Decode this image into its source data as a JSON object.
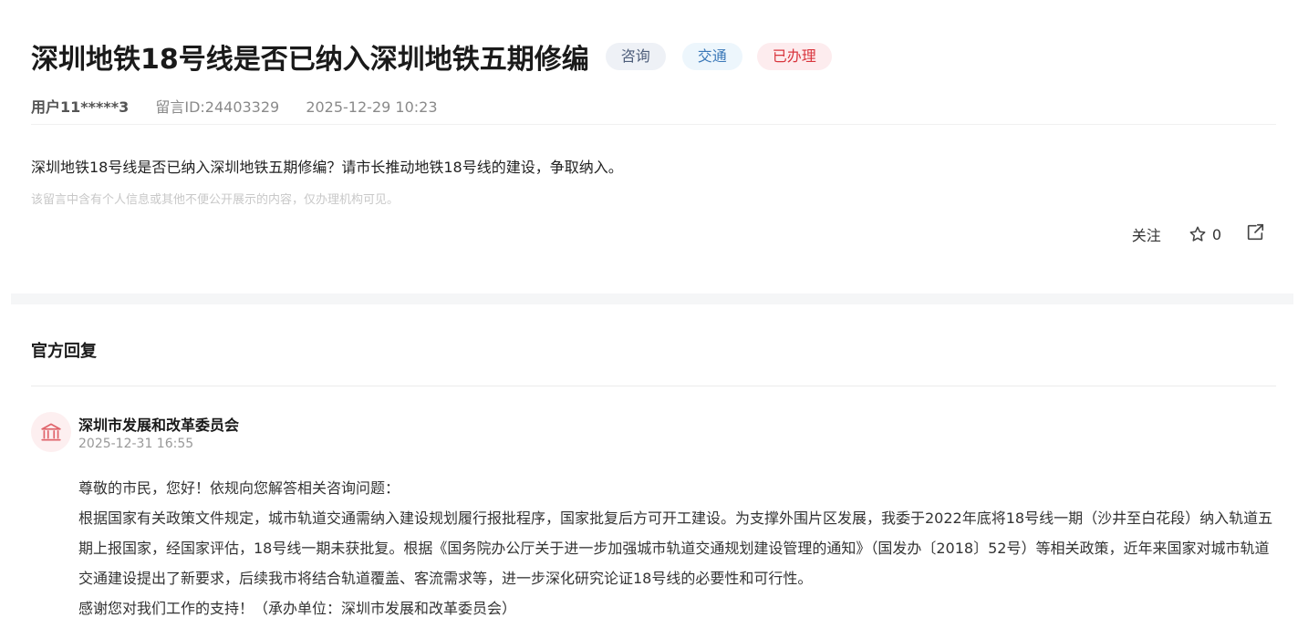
{
  "header": {
    "title": "深圳地铁18号线是否已纳入深圳地铁五期修编",
    "tags": [
      "咨询",
      "交通",
      "已办理"
    ]
  },
  "meta": {
    "user": "用户11*****3",
    "message_id": "留言ID:24403329",
    "datetime": "2025-12-29 10:23"
  },
  "message": {
    "content": "深圳地铁18号线是否已纳入深圳地铁五期修编？请市长推动地铁18号线的建设，争取纳入。",
    "privacy_notice": "该留言中含有个人信息或其他不便公开展示的内容，仅办理机构可见。"
  },
  "actions": {
    "follow_label": "关注",
    "star_count": "0",
    "icons": [
      "star-icon",
      "share-icon"
    ]
  },
  "official_reply": {
    "section_title": "官方回复",
    "org_name": "深圳市发展和改革委员会",
    "org_icon": "government-building-icon",
    "reply_date": "2025-12-31 16:55",
    "greeting": "尊敬的市民，您好！依规向您解答相关咨询问题：",
    "body": "根据国家有关政策文件规定，城市轨道交通需纳入建设规划履行报批程序，国家批复后方可开工建设。为支撑外围片区发展，我委于2022年底将18号线一期（沙井至白花段）纳入轨道五期上报国家，经国家评估，18号线一期未获批复。根据《国务院办公厅关于进一步加强城市轨道交通规划建设管理的通知》（国发办〔2018〕52号）等相关政策，近年来国家对城市轨道交通建设提出了新要求，后续我市将结合轨道覆盖、客流需求等，进一步深化研究论证18号线的必要性和可行性。",
    "closing": "感谢您对我们工作的支持！（承办单位：深圳市发展和改革委员会）"
  },
  "colors": {
    "tag_consult_bg": "#eef1f6",
    "tag_traffic_text": "#3a78b8",
    "tag_done_text": "#d9363e",
    "org_icon": "#e0646b"
  }
}
